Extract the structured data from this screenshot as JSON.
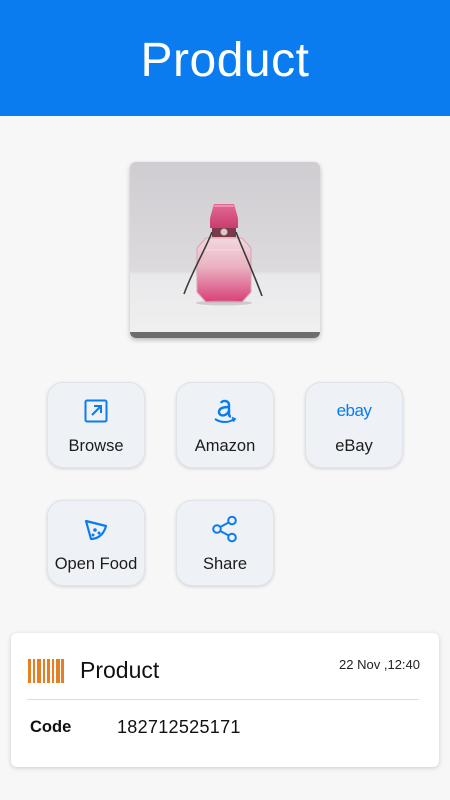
{
  "header": {
    "title": "Product"
  },
  "actions": [
    {
      "label": "Browse",
      "icon": "browse-icon"
    },
    {
      "label": "Amazon",
      "icon": "amazon-icon"
    },
    {
      "label": "eBay",
      "icon": "ebay-icon",
      "icon_text": "ebay"
    },
    {
      "label": "Open Food",
      "icon": "pizza-slice-icon"
    },
    {
      "label": "Share",
      "icon": "share-icon"
    }
  ],
  "card": {
    "title": "Product",
    "date": "22 Nov ,12:40",
    "field_label": "Code",
    "field_value": "182712525171"
  },
  "colors": {
    "primary": "#0b7cf0",
    "barcode": "#e67e22",
    "button_bg": "#eef1f6"
  }
}
